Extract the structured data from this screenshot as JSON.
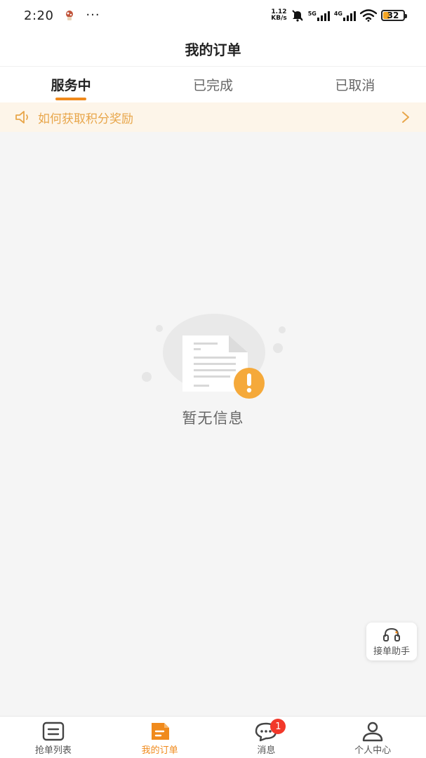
{
  "status_bar": {
    "time": "2:20",
    "more": "···",
    "speed_value": "1.12",
    "speed_unit": "KB/s",
    "net1": "5G",
    "net2": "4G",
    "battery": "32"
  },
  "header": {
    "title": "我的订单"
  },
  "tabs": [
    {
      "label": "服务中",
      "active": true
    },
    {
      "label": "已完成",
      "active": false
    },
    {
      "label": "已取消",
      "active": false
    }
  ],
  "notice": {
    "text": "如何获取积分奖励"
  },
  "empty_state": {
    "text": "暂无信息"
  },
  "assistant": {
    "label": "接单助手"
  },
  "tabbar": [
    {
      "label": "抢单列表",
      "icon": "list-icon",
      "active": false
    },
    {
      "label": "我的订单",
      "icon": "order-icon",
      "active": true
    },
    {
      "label": "消息",
      "icon": "message-icon",
      "active": false,
      "badge": "1"
    },
    {
      "label": "个人中心",
      "icon": "user-icon",
      "active": false
    }
  ],
  "colors": {
    "accent": "#f08a1c",
    "notice_bg": "#fdf5e9",
    "notice_text": "#e8a64a",
    "badge": "#f2382a"
  }
}
